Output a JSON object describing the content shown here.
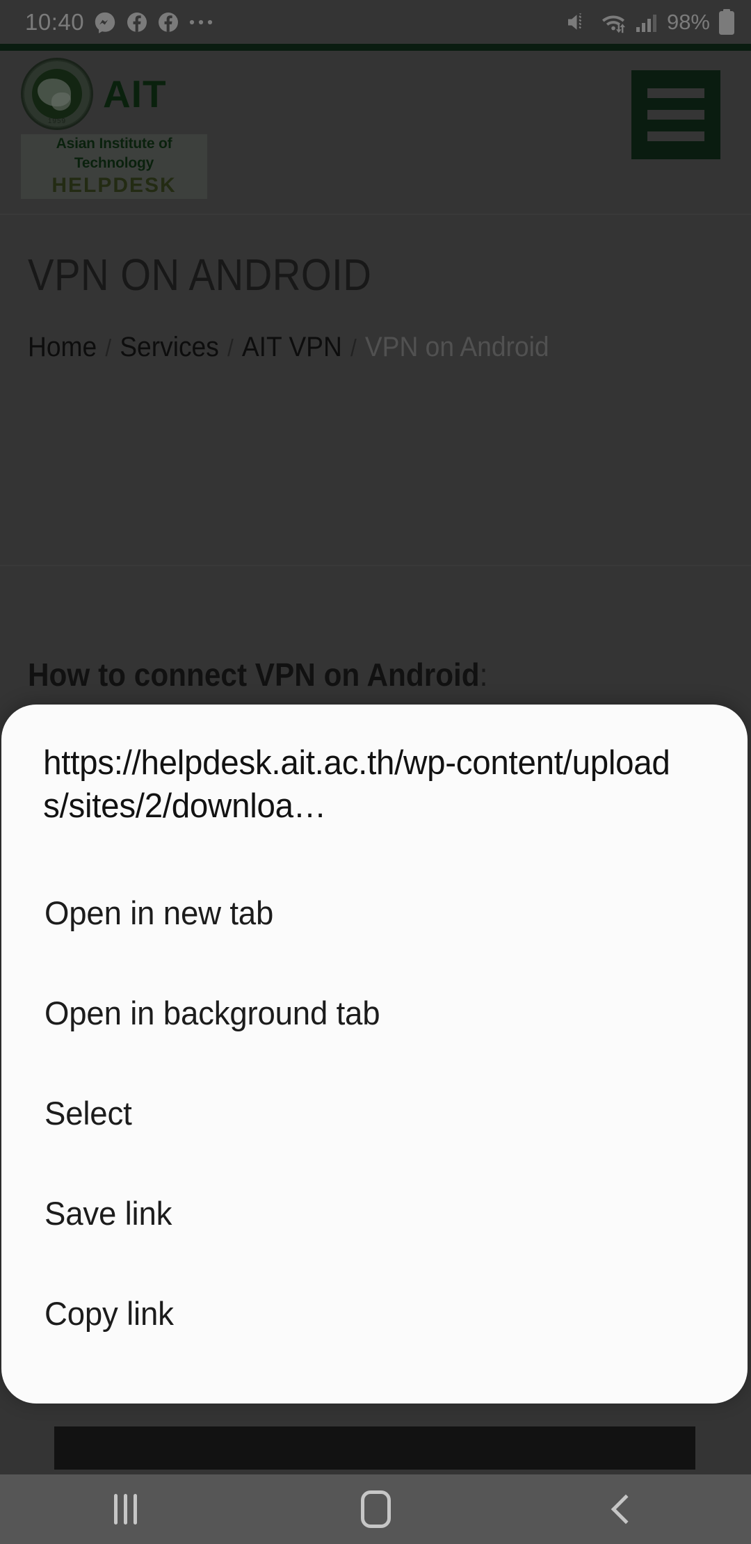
{
  "status_bar": {
    "time": "10:40",
    "notification_icons": [
      "messenger-icon",
      "facebook-icon",
      "facebook-icon",
      "more-dots-icon"
    ],
    "mute_icon": "mute-vibrate-icon",
    "wifi_icon": "wifi-transfer-icon",
    "signal_icon": "cellular-signal-icon",
    "battery_percent": "98%",
    "battery_icon": "battery-full-icon"
  },
  "site_header": {
    "logo_alt": "AIT seal",
    "seal_ring_text": "ASIAN INSTITUTE OF TECHNOLOGY",
    "seal_year": "1959",
    "brand": "AIT",
    "institute_line": "Asian Institute of Technology",
    "helpdesk_line": "HELPDESK",
    "menu_icon": "hamburger-menu-icon"
  },
  "page": {
    "title": "VPN ON ANDROID",
    "breadcrumb": [
      {
        "label": "Home",
        "current": false
      },
      {
        "label": "Services",
        "current": false
      },
      {
        "label": "AIT VPN",
        "current": false
      },
      {
        "label": "VPN on Android",
        "current": true
      }
    ],
    "breadcrumb_separator": "/",
    "heading": "How to connect VPN on Android",
    "heading_suffix": ":"
  },
  "context_sheet": {
    "url_line1": "https://helpdesk.ait.ac.th/wp",
    "url_line2": "-content/uploads/sites/2/downloa…",
    "items": [
      {
        "label": "Open in new tab"
      },
      {
        "label": "Open in background tab"
      },
      {
        "label": "Select"
      },
      {
        "label": "Save link"
      },
      {
        "label": "Copy link"
      }
    ]
  },
  "nav_bar": {
    "recents_icon": "recents-icon",
    "home_icon": "home-icon",
    "back_icon": "back-icon"
  },
  "colors": {
    "brand_green": "#12311d",
    "scrim": "rgba(0,0,0,0.42)",
    "sheet_bg": "#fbfbfb",
    "page_bg": "#5a5a5a"
  }
}
